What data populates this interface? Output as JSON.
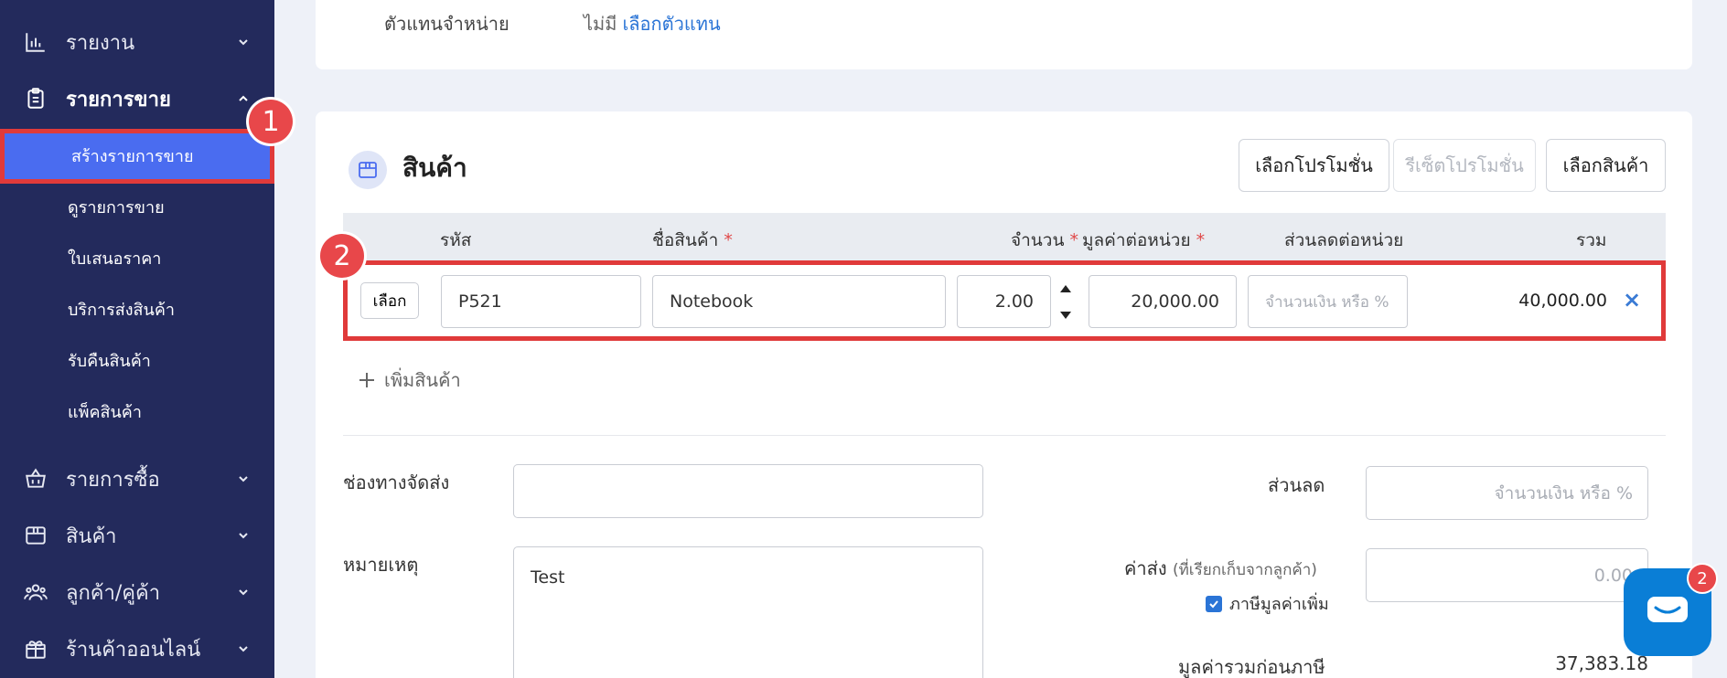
{
  "sidebar": {
    "items": [
      {
        "label": "รายงาน",
        "icon": "bar-chart-icon"
      },
      {
        "label": "รายการขาย",
        "icon": "clipboard-icon"
      },
      {
        "label": "รายการซื้อ",
        "icon": "basket-icon"
      },
      {
        "label": "สินค้า",
        "icon": "box-icon"
      },
      {
        "label": "ลูกค้า/คู่ค้า",
        "icon": "users-icon"
      },
      {
        "label": "ร้านค้าออนไลน์",
        "icon": "gift-icon"
      }
    ],
    "sub_items": [
      {
        "label": "สร้างรายการขาย"
      },
      {
        "label": "ดูรายการขาย"
      },
      {
        "label": "ใบเสนอราคา"
      },
      {
        "label": "บริการส่งสินค้า"
      },
      {
        "label": "รับคืนสินค้า"
      },
      {
        "label": "แพ็คสินค้า"
      }
    ]
  },
  "annotations": {
    "badge1": "1",
    "badge2": "2"
  },
  "agent": {
    "label": "ตัวแทนจำหน่าย",
    "value": "ไม่มี",
    "link": "เลือกตัวแทน"
  },
  "products": {
    "title": "สินค้า",
    "buttons": {
      "promo": "เลือกโปรโมชั่น",
      "reset_promo": "รีเซ็ตโปรโมชั่น",
      "select_product": "เลือกสินค้า"
    },
    "columns": {
      "code": "รหัส",
      "name": "ชื่อสินค้า",
      "qty": "จำนวน",
      "unit_price": "มูลค่าต่อหน่วย",
      "discount": "ส่วนลดต่อหน่วย",
      "total": "รวม"
    },
    "required_mark": "*",
    "row": {
      "select_label": "เลือก",
      "code": "P521",
      "name": "Notebook",
      "qty": "2.00",
      "unit_price": "20,000.00",
      "discount_placeholder": "จำนวนเงิน หรือ %",
      "total": "40,000.00",
      "remove": "×"
    },
    "add_label": "เพิ่มสินค้า"
  },
  "form": {
    "shipping_channel_label": "ช่องทางจัดส่ง",
    "shipping_channel_value": "",
    "note_label": "หมายเหตุ",
    "note_value": "Test",
    "discount_label": "ส่วนลด",
    "discount_placeholder": "จำนวนเงิน หรือ %",
    "shipping_fee_label": "ค่าส่ง",
    "shipping_fee_sub": "(ที่เรียกเก็บจากลูกค้า)",
    "shipping_fee_placeholder": "0.00",
    "vat_label": "ภาษีมูลค่าเพิ่ม",
    "vat_checked": true,
    "subtotal_label": "มูลค่ารวมก่อนภาษี",
    "subtotal_value": "37,383.18"
  },
  "chat": {
    "badge": "2"
  },
  "colors": {
    "sidebar": "#232a5c",
    "selected": "#4a6cf0",
    "highlight": "#e03a3a",
    "link": "#2a74d6",
    "chat": "#0a7ed6"
  }
}
